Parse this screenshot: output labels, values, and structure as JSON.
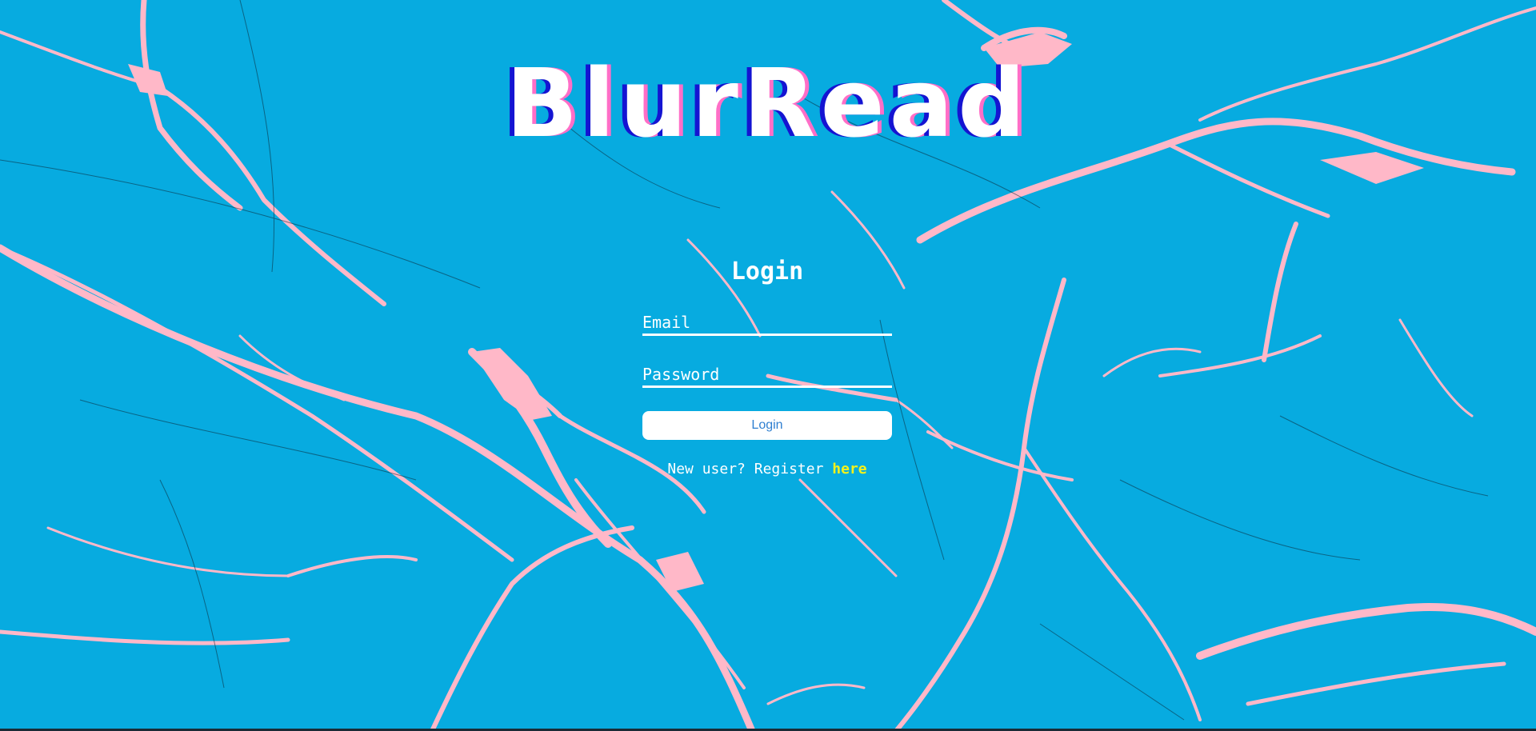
{
  "app": {
    "logo_text": "BlurRead"
  },
  "login": {
    "title": "Login",
    "email_placeholder": "Email",
    "password_placeholder": "Password",
    "button_label": "Login",
    "register_prompt": "New user? Register ",
    "register_link": "here"
  },
  "colors": {
    "background": "#07abe0",
    "cracks": "#ffb8c8",
    "link": "#f4f21a",
    "button_text": "#2f7fd0"
  }
}
